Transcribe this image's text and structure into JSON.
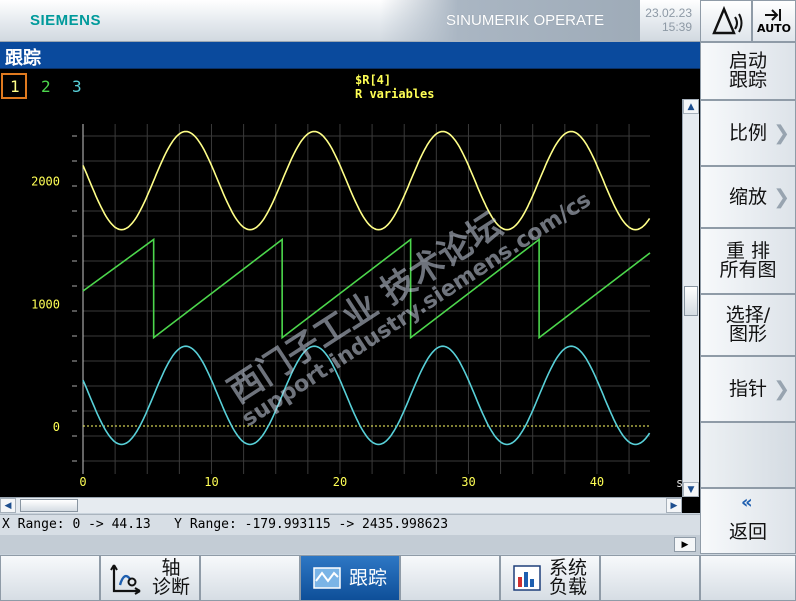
{
  "header": {
    "brand": "SIEMENS",
    "product": "SINUMERIK OPERATE",
    "date": "23.02.23",
    "time": "15:39",
    "auto_label": "AUTO"
  },
  "title": "跟踪",
  "trace_selector": [
    "1",
    "2",
    "3"
  ],
  "legend": {
    "variable": "$R[4]",
    "description": "R variables"
  },
  "watermark": {
    "line1": "西门子工业 技术论坛",
    "line2": "support.industry.siemens.com/cs"
  },
  "status": "X Range: 0 -> 44.13   Y Range: -179.993115 -> 2435.998623",
  "x_unit": "s",
  "vertical_softkeys": [
    {
      "label": "启动\n跟踪",
      "arrow": false
    },
    {
      "label": "比例",
      "arrow": true
    },
    {
      "label": "缩放",
      "arrow": true
    },
    {
      "label": "重 排\n所有图",
      "arrow": false
    },
    {
      "label": "选择/\n图形",
      "arrow": false
    },
    {
      "label": "指针",
      "arrow": true
    },
    {
      "label": "",
      "arrow": false
    },
    {
      "label": "返回",
      "arrow": false
    }
  ],
  "horizontal_softkeys": [
    {
      "label": "",
      "icon": ""
    },
    {
      "label": "轴\n诊断",
      "icon": "axis-diagnosis-icon"
    },
    {
      "label": "",
      "icon": ""
    },
    {
      "label": "跟踪",
      "icon": "trace-icon",
      "active": true
    },
    {
      "label": "",
      "icon": ""
    },
    {
      "label": "系统\n负载",
      "icon": "system-load-icon"
    },
    {
      "label": "",
      "icon": ""
    }
  ],
  "colors": {
    "series1": "#ffff88",
    "series2": "#4cd64c",
    "series3": "#58d0d8",
    "axis_label": "#ffff55",
    "title_bar": "#0a4a9d"
  },
  "chart_data": {
    "type": "line",
    "xlim": [
      0,
      44.13
    ],
    "ylim": [
      -179.993115,
      2435.998623
    ],
    "x_ticks": [
      0,
      10,
      20,
      30,
      40
    ],
    "y_ticks": [
      0,
      1000,
      2000
    ],
    "grid": true,
    "series": [
      {
        "name": "1",
        "kind": "sine",
        "mean": 2000,
        "amplitude": 400,
        "period": 10,
        "peak_at": 8
      },
      {
        "name": "2",
        "kind": "sawtooth",
        "start": 1100,
        "end": 1520,
        "low": 720,
        "period": 10,
        "first_drop": 5.5
      },
      {
        "name": "3",
        "kind": "sine",
        "mean": 250,
        "amplitude": 400,
        "period": 10,
        "peak_at": 8
      }
    ]
  }
}
